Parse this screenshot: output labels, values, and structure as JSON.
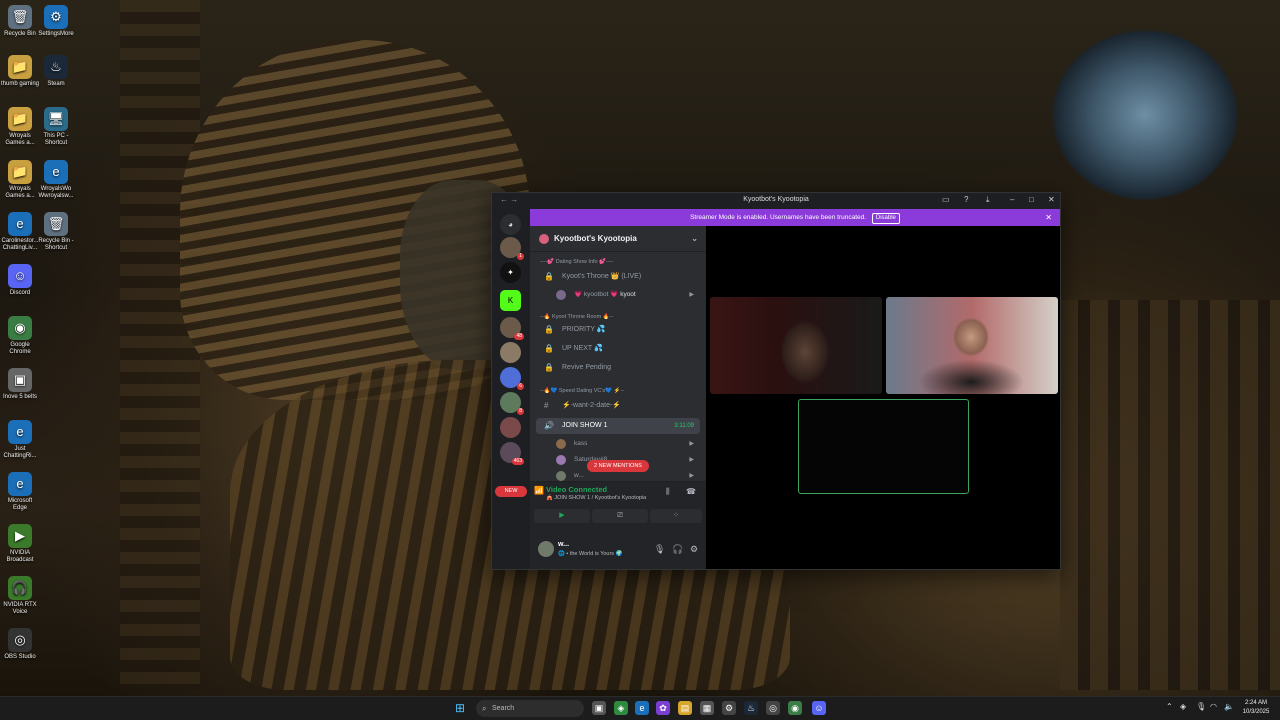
{
  "desktop": {
    "icons": [
      {
        "label": "Recycle Bin",
        "glyph": "🗑"
      },
      {
        "label": "SettingsMore",
        "glyph": "⚙"
      },
      {
        "label": "thumb gaming",
        "glyph": "📁"
      },
      {
        "label": "Steam",
        "glyph": "♨"
      },
      {
        "label": "Wroyals Games a...",
        "glyph": "📁"
      },
      {
        "label": "This PC - Shortcut",
        "glyph": "🖥"
      },
      {
        "label": "Wroyals Games a...",
        "glyph": "📁"
      },
      {
        "label": "WroyalsWo Wwroyalsw...",
        "glyph": "e"
      },
      {
        "label": "Carolinestor... ChattingLiv...",
        "glyph": "e"
      },
      {
        "label": "Recycle Bin - Shortcut",
        "glyph": "🗑"
      },
      {
        "label": "Discord",
        "glyph": "☺"
      },
      {
        "label": "Google Chrome",
        "glyph": "◉"
      },
      {
        "label": "Inove 5 belts",
        "glyph": "▣"
      },
      {
        "label": "Just ChattingRi...",
        "glyph": "e"
      },
      {
        "label": "Microsoft Edge",
        "glyph": "e"
      },
      {
        "label": "NVIDIA Broadcast",
        "glyph": "▶"
      },
      {
        "label": "NVIDIA RTX Voice",
        "glyph": "🎧"
      },
      {
        "label": "OBS Studio",
        "glyph": "◎"
      }
    ]
  },
  "window": {
    "title": "Kyootbot's Kyootopia",
    "nav_back": "←",
    "nav_fwd": "→"
  },
  "banner": {
    "text": "Streamer Mode is enabled. Usernames have been truncated.",
    "disable_label": "Disable",
    "close": "✕"
  },
  "servers": {
    "badges": [
      "1",
      "",
      "",
      "48",
      "",
      "6",
      "8",
      "",
      "463"
    ],
    "new_label": "NEW"
  },
  "guild": {
    "name": "Kyootbot's Kyootopia"
  },
  "channels": {
    "cat1": "----💕 Dating Show Info 💕----",
    "throne": "Kyoot's Throne 👑 (LIVE)",
    "user_kyootbot": "💗 kyootbot",
    "user_kyootbot_tag": "💗 kyoot",
    "cat2": "--🔥 Kyoot Throne Room 🔥--",
    "priority": "PRIORITY 💦",
    "upnext": "UP NEXT 💦",
    "revive": "Revive Pending",
    "cat3": "--🔥💙 Speed Dating VC's💙 ⚡--",
    "want2date": "⚡-want-2-date-⚡",
    "joinshow": "JOIN SHOW 1",
    "joinshow_time": "3:11:09",
    "user_kass": "kass",
    "user_saturday": "Saturdav#8",
    "user_w": "w...",
    "mentions": "2 NEW MENTIONS"
  },
  "voice": {
    "status": "Video Connected",
    "location": "🎪 JOIN SHOW 1 / Kyootbot's Kyootopia"
  },
  "user": {
    "name": "w...",
    "status": "🌐 • the World is Yours 🌍"
  },
  "taskbar": {
    "search_placeholder": "Search",
    "time": "2:24 AM",
    "date": "10/3/2025"
  },
  "colors": {
    "banner": "#8b3bd9",
    "discord_dark": "#1e1f22",
    "channel_bg": "#2b2d31",
    "connected_green": "#23a55a",
    "mention_red": "#da373c"
  }
}
